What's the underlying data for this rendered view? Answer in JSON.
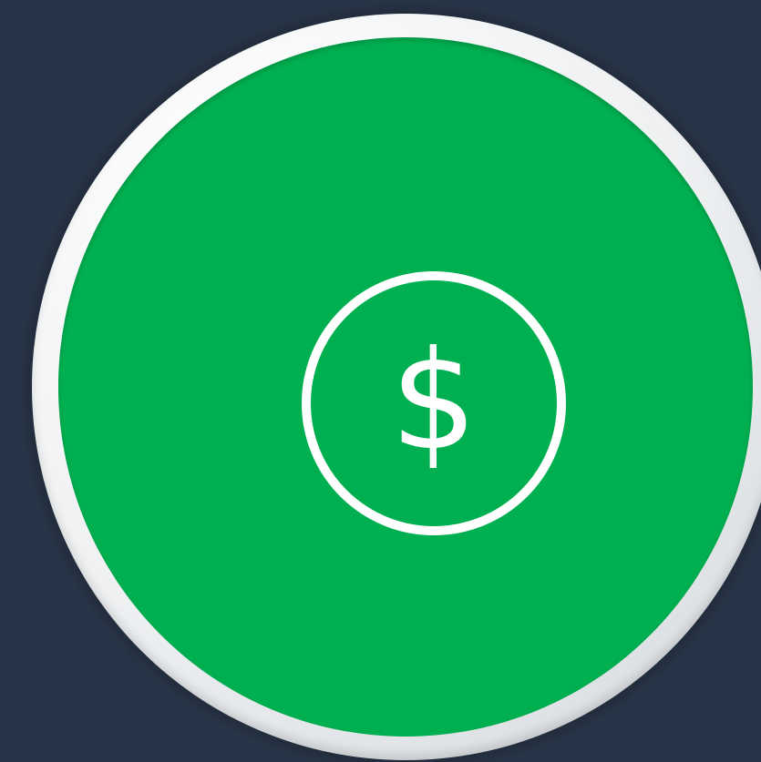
{
  "icon": {
    "name": "dollar-coin-icon",
    "symbol": "$"
  },
  "colors": {
    "background": "#283548",
    "disc_fill": "#00B050",
    "ring": "#EEF0F2",
    "foreground": "#FFFFFF"
  }
}
